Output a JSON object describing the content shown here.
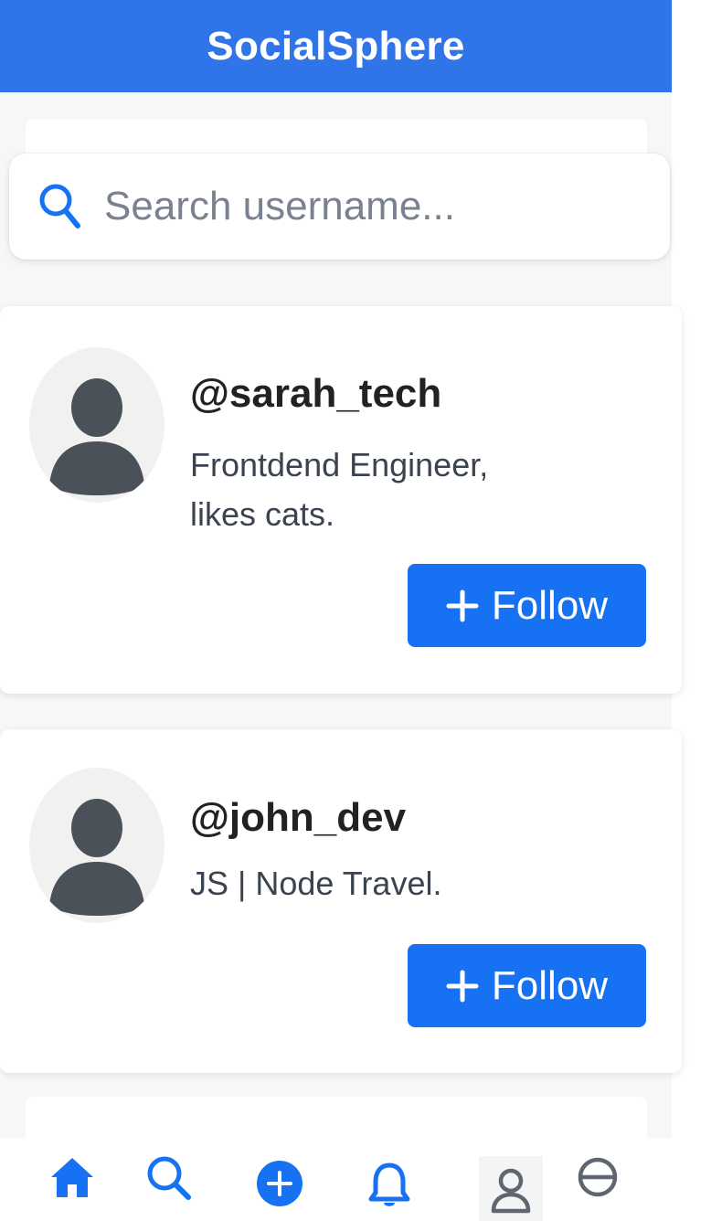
{
  "app": {
    "title": "SocialSphere"
  },
  "colors": {
    "header": "#2f74e8",
    "accent": "#1672f3",
    "avatar_silhouette": "#4b5159"
  },
  "search": {
    "placeholder": "Search username...",
    "value": "",
    "icon": "search-icon"
  },
  "users": [
    {
      "username": "@sarah_tech",
      "bio_lines": [
        "Frontdend Engineer,",
        "likes cats."
      ],
      "follow_label": "Follow"
    },
    {
      "username": "@john_dev",
      "bio_lines": [
        "JS | Node Travel."
      ],
      "follow_label": "Follow"
    }
  ],
  "bottom_nav": {
    "items": [
      {
        "icon": "home-icon",
        "active": true
      },
      {
        "icon": "search-icon",
        "active": true
      },
      {
        "icon": "add-icon",
        "active": true
      },
      {
        "icon": "bell-icon",
        "active": true
      },
      {
        "icon": "profile-icon",
        "active": false
      },
      {
        "icon": "block-icon",
        "active": false
      }
    ]
  }
}
